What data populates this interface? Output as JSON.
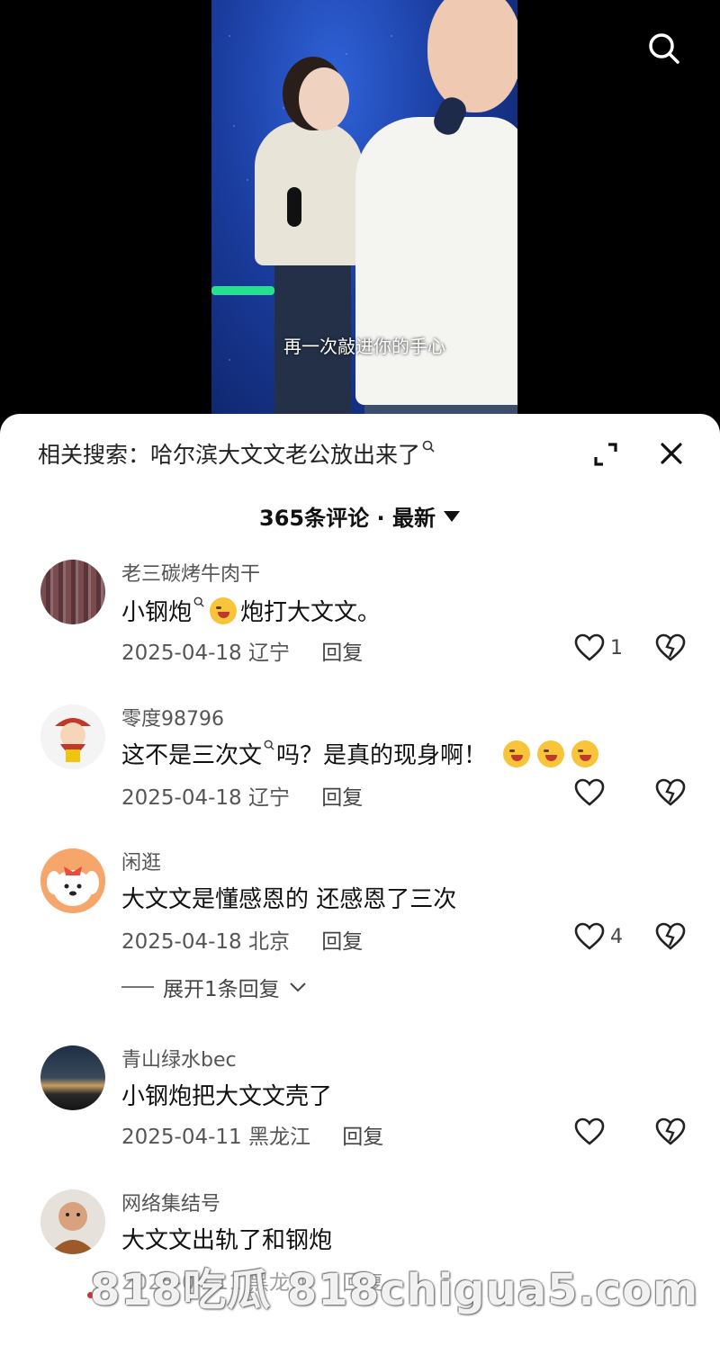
{
  "video": {
    "subtitle": "再一次敲进你的手心"
  },
  "sheet": {
    "related_search": "相关搜索：哈尔滨大文文老公放出来了",
    "comment_count_sort": "365条评论 · 最新"
  },
  "comments": [
    {
      "username": "老三碳烤牛肉干",
      "text_before": "小钢炮",
      "text_after": "炮打大文文。",
      "date": "2025-04-18",
      "location": "辽宁",
      "reply": "回复",
      "likes": "1"
    },
    {
      "username": "零度98796",
      "text_before": "这不是三次文",
      "text_after": "吗？是真的现身啊！",
      "date": "2025-04-18",
      "location": "辽宁",
      "reply": "回复",
      "likes": ""
    },
    {
      "username": "闲逛",
      "text": "大文文是懂感恩的 还感恩了三次",
      "date": "2025-04-18",
      "location": "北京",
      "reply": "回复",
      "likes": "4"
    },
    {
      "username": "青山绿水bec",
      "text": "小钢炮把大文文壳了",
      "date": "2025-04-11",
      "location": "黑龙江",
      "reply": "回复",
      "likes": ""
    },
    {
      "username": "网络集结号",
      "text": "大文文出轨了和钢炮",
      "date": "2025-04-11",
      "location": "黑龙江",
      "reply": "回复",
      "likes": ""
    }
  ],
  "expand_replies": "展开1条回复",
  "watermark": "818吃瓜 818chigua5.com",
  "icons": {
    "search": "search-icon",
    "expand": "expand-icon",
    "close": "close-icon",
    "like": "heart-icon",
    "dislike": "broken-heart-icon"
  }
}
